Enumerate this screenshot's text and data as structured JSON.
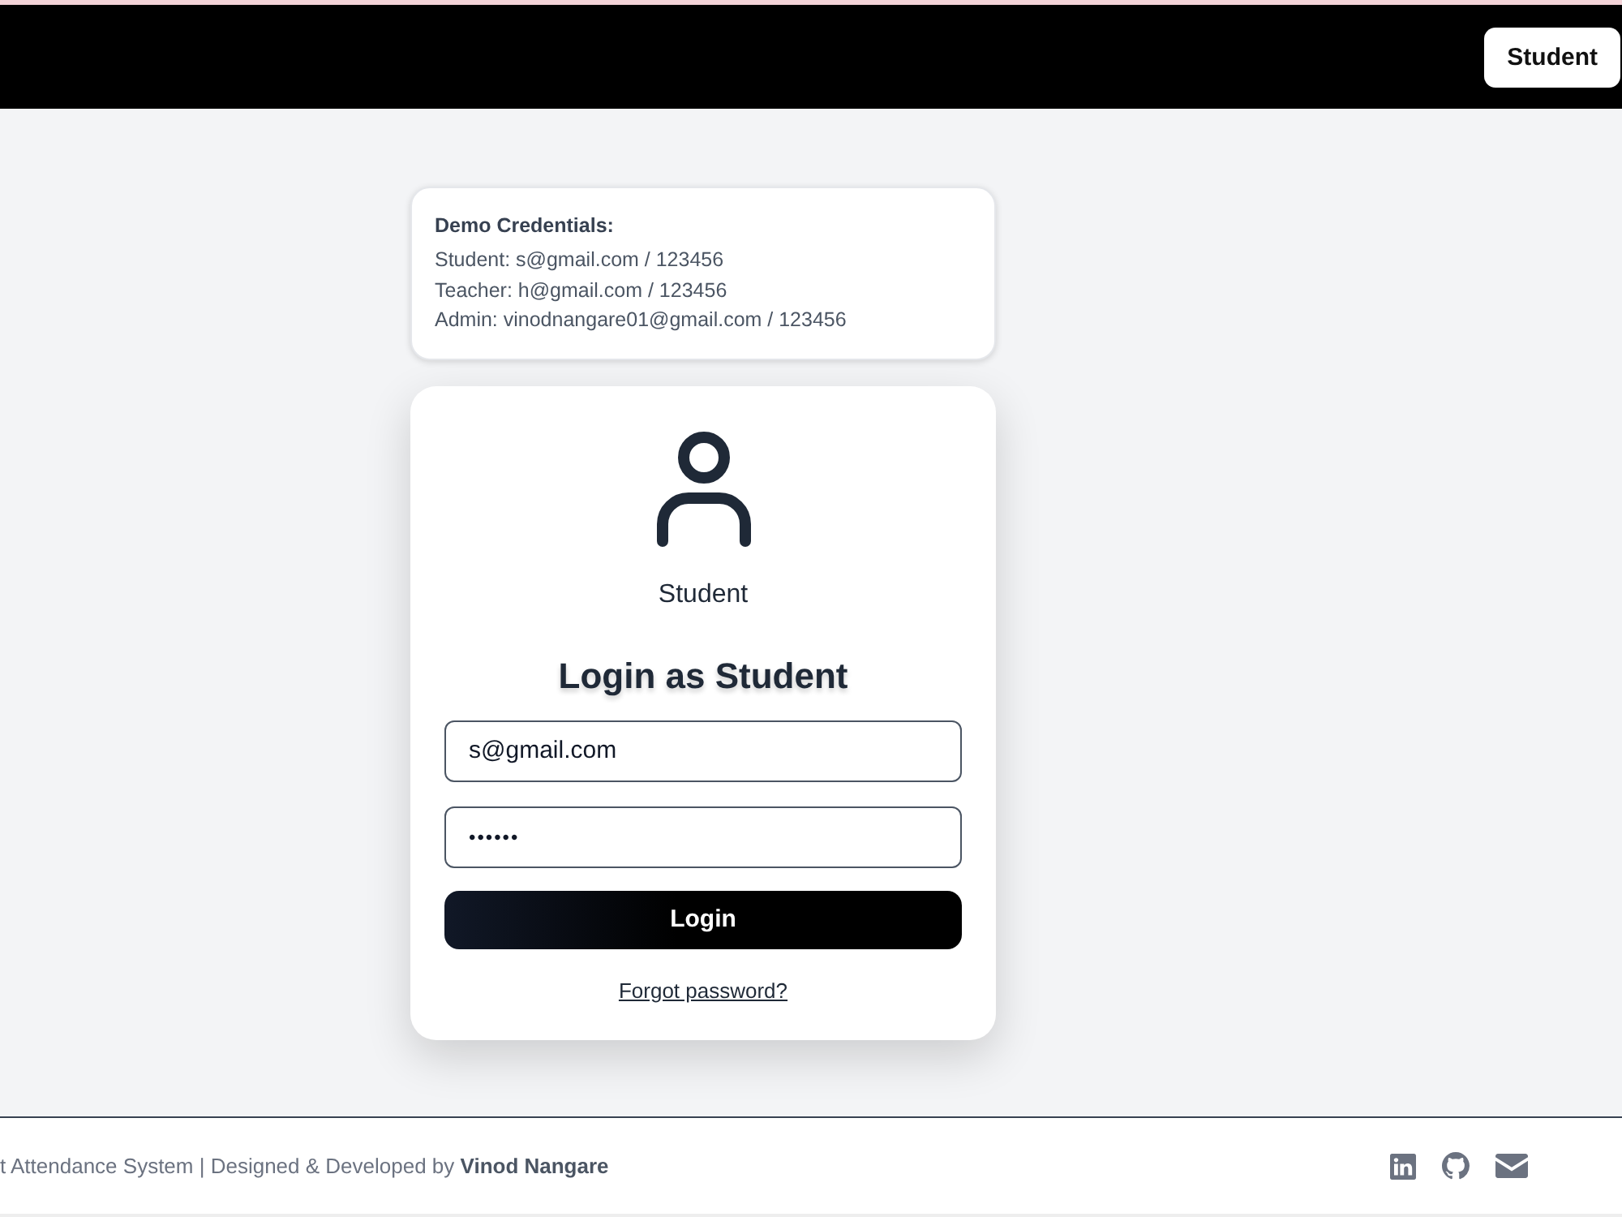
{
  "header": {
    "button": {
      "label": "Student"
    }
  },
  "demo_credentials": {
    "title": "Demo Credentials:",
    "lines": [
      "Student: s@gmail.com / 123456",
      "Teacher: h@gmail.com / 123456",
      "Admin: vinodnangare01@gmail.com / 123456"
    ]
  },
  "login_card": {
    "role_label": "Student",
    "heading": "Login as Student",
    "fields": [
      {
        "kind": "email",
        "value": "s@gmail.com"
      },
      {
        "kind": "password",
        "value": "••••••"
      }
    ],
    "submit_button": "Login",
    "forgot_link": "Forgot password?"
  },
  "footer": {
    "text": "t Attendance System | Designed & Developed by **Vinod Nangare**"
  }
}
